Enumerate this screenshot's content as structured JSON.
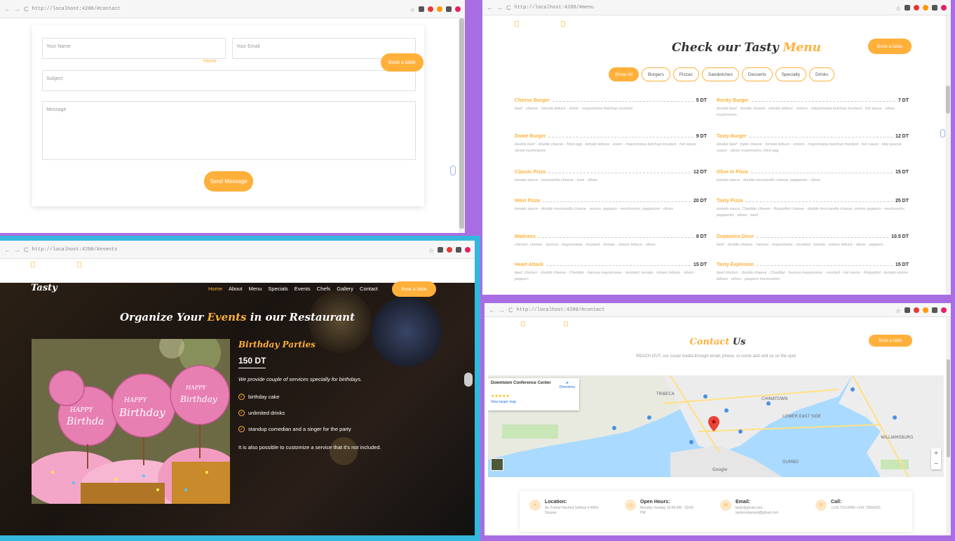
{
  "contact_form": {
    "url": "http://localhost:4200/#contact",
    "home_link": "Home",
    "book_button": "Book a table",
    "name_placeholder": "Your Name",
    "email_placeholder": "Your Email",
    "subject_placeholder": "Subject",
    "message_placeholder": "Message",
    "send_button": "Send Message"
  },
  "menu_page": {
    "url": "http://localhost:4200/#menu",
    "title_prefix": "Check our Tasty ",
    "title_highlight": "Menu",
    "book_button": "Book a table",
    "filters": [
      "Show All",
      "Burgers",
      "Pizzas",
      "Sandwiches",
      "Desserts",
      "Specialty",
      "Drinks"
    ],
    "active_filter": "Show All",
    "items_left": [
      {
        "name": "Cheese Burger",
        "price": "5 DT",
        "desc": "beef · cheese · tomato lettuce · onion · mayonnaise ketchup mustard"
      },
      {
        "name": "Dome Burger",
        "price": "9 DT",
        "desc": "double beef · double cheese · fried egg · tomato lettuce · onion · mayonnaise ketchup mustard · hot sauce · sliced mushrooms"
      },
      {
        "name": "Classic Pizza",
        "price": "12 DT",
        "desc": "tomato sauce · mozzarella cheese · ham · olives"
      },
      {
        "name": "West Pizza",
        "price": "20 DT",
        "desc": "tomato sauce · double mozzarella cheese · onions, peppers · mushrooms, pepperoni · olives"
      },
      {
        "name": "Madness",
        "price": "8 DT",
        "desc": "chicken, cheese · harissa · mayonnaise · mustard · tomato · onions lettuce · olives"
      },
      {
        "name": "Heart Attack",
        "price": "15 DT",
        "desc": "beef, chicken · double cheese · Cheddar · harissa mayonnaise · mustard, tomato · onions lettuce · olives · peppers"
      }
    ],
    "items_right": [
      {
        "name": "Rocky Burger",
        "price": "7 DT",
        "desc": "double beef · double cheese · tomato lettuce · onions · mayonnaise ketchup mustard · hot sauce · olives · mushrooms"
      },
      {
        "name": "Tasty Burger",
        "price": "12 DT",
        "desc": "double beef · triple cheese · tomato lettuce · onions · mayonnaise ketchup mustard · hot sauce · bbq special sauce · olives mushrooms, fried egg"
      },
      {
        "name": "Olive In Pizza",
        "price": "15 DT",
        "desc": "tomato sauce · double mozzarella cheese, pepperoni · olives"
      },
      {
        "name": "Tasty Pizza",
        "price": "25 DT",
        "desc": "tomato sauce, Cheddar cheese · Roquefort cheese · double mozzarella cheese, onions peppers · mushrooms, pepperoni · olives · beef"
      },
      {
        "name": "Dopamine Dose",
        "price": "10.5 DT",
        "desc": "beef · double cheese · harissa · mayonnaise · mustard · tomato · onions lettuce · olives · peppers"
      },
      {
        "name": "Tasty Explosion",
        "price": "15 DT",
        "desc": "beef chicken · double cheese · Cheddar · harissa mayonnaise · mustard · hot sauce · Roquefort · tomato onions lettuce · olives · peppers mushrooms"
      }
    ]
  },
  "events_page": {
    "url": "http://localhost:4200/#events",
    "logo": "Tasty",
    "nav": [
      "Home",
      "About",
      "Menu",
      "Specials",
      "Events",
      "Chefs",
      "Gallery",
      "Contact"
    ],
    "nav_active": "Home",
    "book_button": "Book a table",
    "heading_prefix": "Organize Your ",
    "heading_highlight": "Events",
    "heading_suffix": " in our Restaurant",
    "event_title": "Birthday Parties",
    "price": "150 DT",
    "description": "We provide couple of services specially for birthdays.",
    "services": [
      "birthday cake",
      "unlimited drinks",
      "standup comedian and a singer for the party"
    ],
    "note": "It is also possible to customize a service that it's not included.",
    "topper_text": "HAPPY Birthday"
  },
  "contact_page": {
    "url": "http://localhost:4200/#contact",
    "title_highlight": "Contact",
    "title_suffix": " Us",
    "book_button": "Book a table",
    "subtitle": "REACH OUT, our social media through email, phone, or come and visit us on the spot",
    "map_place": "Downtown Conference Center",
    "map_directions": "Directions",
    "map_larger": "View larger map",
    "map_labels": [
      "CHINATOWN",
      "LOWER EAST SIDE",
      "TRIBECA",
      "DUMBO",
      "WILLIAMSBURG",
      "Google"
    ],
    "info": [
      {
        "title": "Location:",
        "text": "Av. Farhat Hached Sahloul 4 4054, Sousse",
        "icon": "map-pin-icon"
      },
      {
        "title": "Open Hours:",
        "text": "Monday-Sunday 10:00 AM - 23:00 PM",
        "icon": "clock-icon"
      },
      {
        "title": "Email:",
        "text": "tasty@gmail.com tastyrestaurant@gmail.com",
        "icon": "envelope-icon"
      },
      {
        "title": "Call:",
        "text": "+216 73123456 +216 73654321",
        "icon": "phone-icon"
      }
    ]
  },
  "colors": {
    "accent": "#ffb03b",
    "frame_purple": "#a86de3",
    "frame_cyan": "#35b6dd"
  }
}
